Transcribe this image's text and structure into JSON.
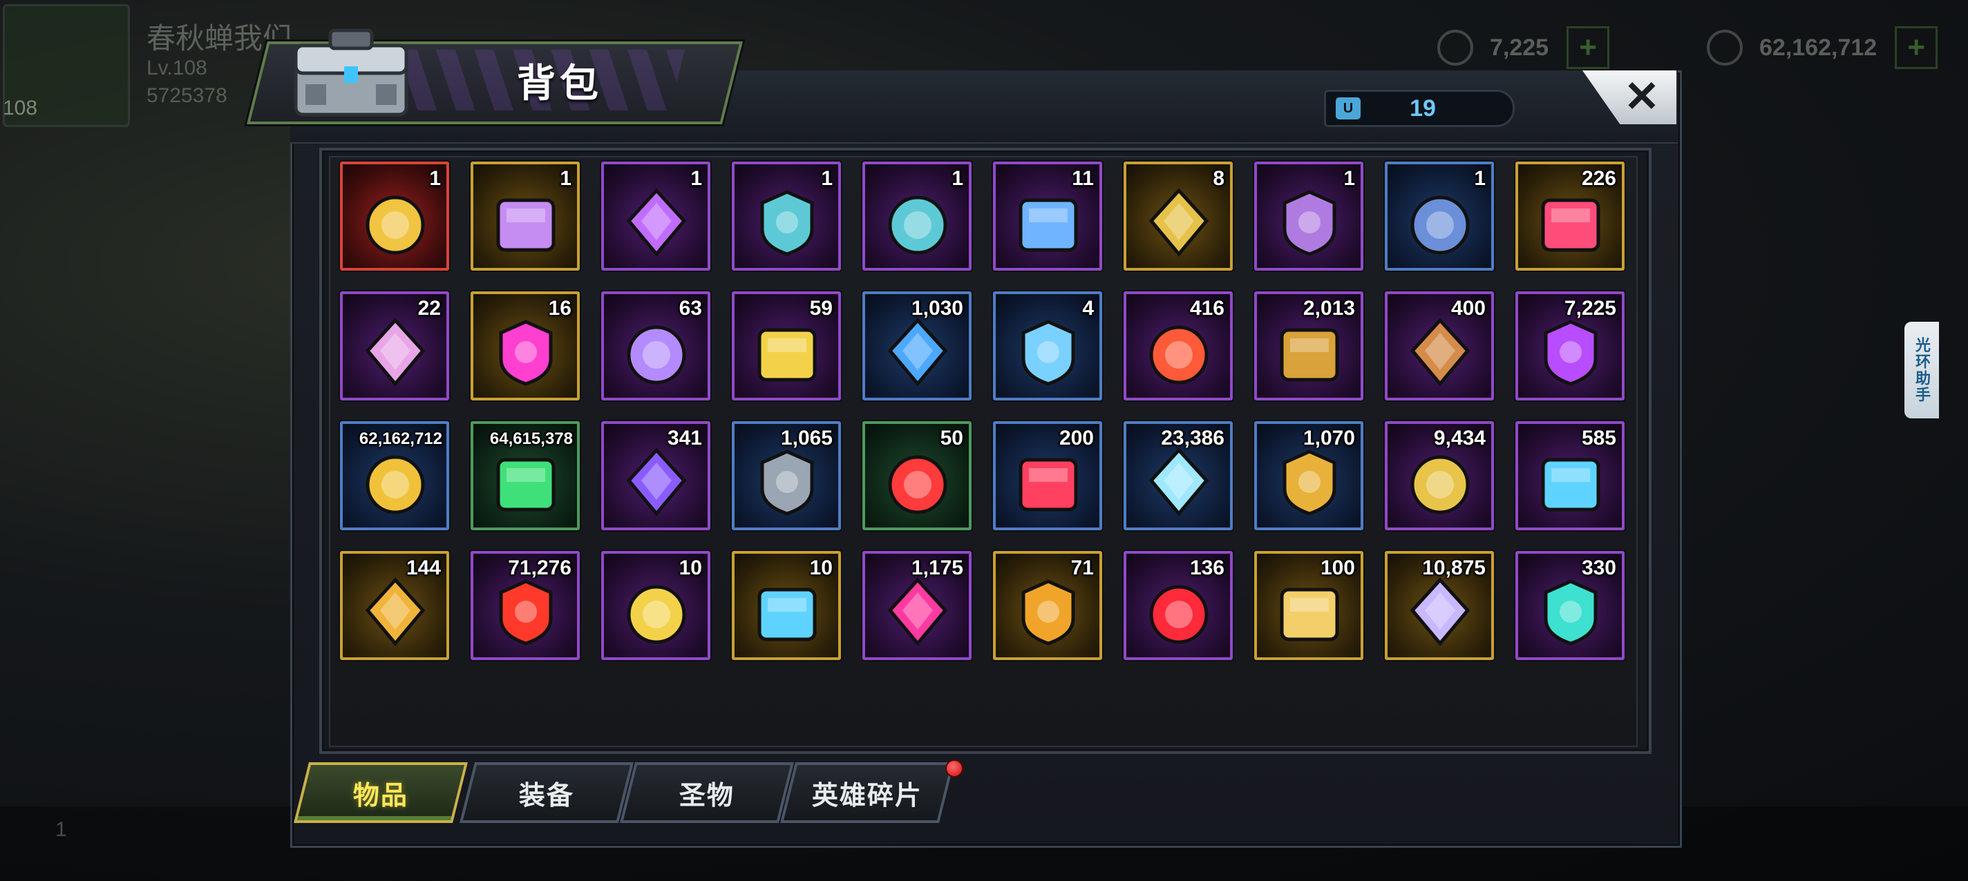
{
  "background": {
    "player_name": "春秋蝉我们",
    "level": "Lv.108",
    "level_badge": "108",
    "power": "5725378",
    "resources": [
      {
        "value": "7,225"
      },
      {
        "value": "62,162,712"
      }
    ],
    "friends_count": "1"
  },
  "helper_tab": {
    "label": "光环助手"
  },
  "panel": {
    "title": "背包",
    "capacity_icon": "U",
    "capacity": "19",
    "close_label": "✕"
  },
  "items": [
    {
      "qty": "1",
      "rarity": "red",
      "icon": "gold-chest-ii-icon",
      "color": "#f1c442"
    },
    {
      "qty": "1",
      "rarity": "gold",
      "icon": "ur-chest-lvs-icon",
      "color": "#c58cf2"
    },
    {
      "qty": "1",
      "rarity": "purple",
      "icon": "iv-crate-icon",
      "color": "#c06dff"
    },
    {
      "qty": "1",
      "rarity": "purple",
      "icon": "ss-chest-icon",
      "color": "#5ec9d6"
    },
    {
      "qty": "1",
      "rarity": "purple",
      "icon": "ss-chest-icon",
      "color": "#5ec9d6"
    },
    {
      "qty": "11",
      "rarity": "purple",
      "icon": "device-icon",
      "color": "#6fb4ff"
    },
    {
      "qty": "8",
      "rarity": "gold",
      "icon": "24h-card-icon",
      "color": "#e6c24a"
    },
    {
      "qty": "1",
      "rarity": "purple",
      "icon": "12h-card-icon",
      "color": "#b07be0"
    },
    {
      "qty": "1",
      "rarity": "blue",
      "icon": "4h-card-icon",
      "color": "#6b8fd8"
    },
    {
      "qty": "226",
      "rarity": "gold",
      "icon": "bottle-cap-icon",
      "color": "#ff4d7a"
    },
    {
      "qty": "22",
      "rarity": "purple",
      "icon": "film-reel-icon",
      "color": "#e8a6e8"
    },
    {
      "qty": "16",
      "rarity": "gold",
      "icon": "s-cap-icon",
      "color": "#ff3fd0"
    },
    {
      "qty": "63",
      "rarity": "purple",
      "icon": "casino-chip-icon",
      "color": "#b38bff"
    },
    {
      "qty": "59",
      "rarity": "purple",
      "icon": "police-badge-icon",
      "color": "#f3d24a"
    },
    {
      "qty": "1,030",
      "rarity": "blue",
      "icon": "cinema-ticket-icon",
      "color": "#4da8ff"
    },
    {
      "qty": "4",
      "rarity": "blue",
      "icon": "b-cap-icon",
      "color": "#7ad0ff"
    },
    {
      "qty": "416",
      "rarity": "purple",
      "icon": "poker-chip-icon",
      "color": "#ff5a3a"
    },
    {
      "qty": "2,013",
      "rarity": "purple",
      "icon": "bullet-icon",
      "color": "#d9a23a"
    },
    {
      "qty": "400",
      "rarity": "purple",
      "icon": "gingerbread-icon",
      "color": "#d58b4a"
    },
    {
      "qty": "7,225",
      "rarity": "purple",
      "icon": "purple-gem-icon",
      "color": "#b84cff"
    },
    {
      "qty": "62,162,712",
      "rarity": "blue",
      "icon": "gold-coins-icon",
      "color": "#f0c23a",
      "small": true
    },
    {
      "qty": "64,615,378",
      "rarity": "green",
      "icon": "green-battery-icon",
      "color": "#3fe07a",
      "small": true
    },
    {
      "qty": "341",
      "rarity": "purple",
      "icon": "purple-core-icon",
      "color": "#8a5cff"
    },
    {
      "qty": "1,065",
      "rarity": "blue",
      "icon": "gear-icon",
      "color": "#9aa6b4"
    },
    {
      "qty": "50",
      "rarity": "green",
      "icon": "red-node-icon",
      "color": "#ff3b3b"
    },
    {
      "qty": "200",
      "rarity": "blue",
      "icon": "helmet-icon",
      "color": "#ff4060"
    },
    {
      "qty": "23,386",
      "rarity": "blue",
      "icon": "crystal-shard-icon",
      "color": "#9fe8ff"
    },
    {
      "qty": "1,070",
      "rarity": "blue",
      "icon": "gold-fist-icon",
      "color": "#e8b23a"
    },
    {
      "qty": "9,434",
      "rarity": "purple",
      "icon": "puzzle-piece-icon",
      "color": "#e8c44a"
    },
    {
      "qty": "585",
      "rarity": "purple",
      "icon": "tech-badge-icon",
      "color": "#5fd3ff"
    },
    {
      "qty": "144",
      "rarity": "gold",
      "icon": "gold-badge-icon",
      "color": "#f0b43a"
    },
    {
      "qty": "71,276",
      "rarity": "purple",
      "icon": "biohazard-icon",
      "color": "#ff3a2a"
    },
    {
      "qty": "10",
      "rarity": "purple",
      "icon": "lightning-coin-icon",
      "color": "#f3d24a"
    },
    {
      "qty": "10",
      "rarity": "gold",
      "icon": "propeller-icon",
      "color": "#5fd3ff"
    },
    {
      "qty": "1,175",
      "rarity": "purple",
      "icon": "magenta-crystal-icon",
      "color": "#ff3aa0"
    },
    {
      "qty": "71",
      "rarity": "gold",
      "icon": "gold-stack-icon",
      "color": "#f0a52a"
    },
    {
      "qty": "136",
      "rarity": "purple",
      "icon": "red-orb-icon",
      "color": "#ff2a3a"
    },
    {
      "qty": "100",
      "rarity": "gold",
      "icon": "potion-icon",
      "color": "#f3cf6a"
    },
    {
      "qty": "10,875",
      "rarity": "gold",
      "icon": "jersey-badge-icon",
      "color": "#c8b8ff"
    },
    {
      "qty": "330",
      "rarity": "purple",
      "icon": "dna-icon",
      "color": "#3ee0d0"
    }
  ],
  "tabs": [
    {
      "label": "物品",
      "active": true
    },
    {
      "label": "装备",
      "active": false
    },
    {
      "label": "圣物",
      "active": false
    },
    {
      "label": "英雄碎片",
      "active": false
    }
  ]
}
